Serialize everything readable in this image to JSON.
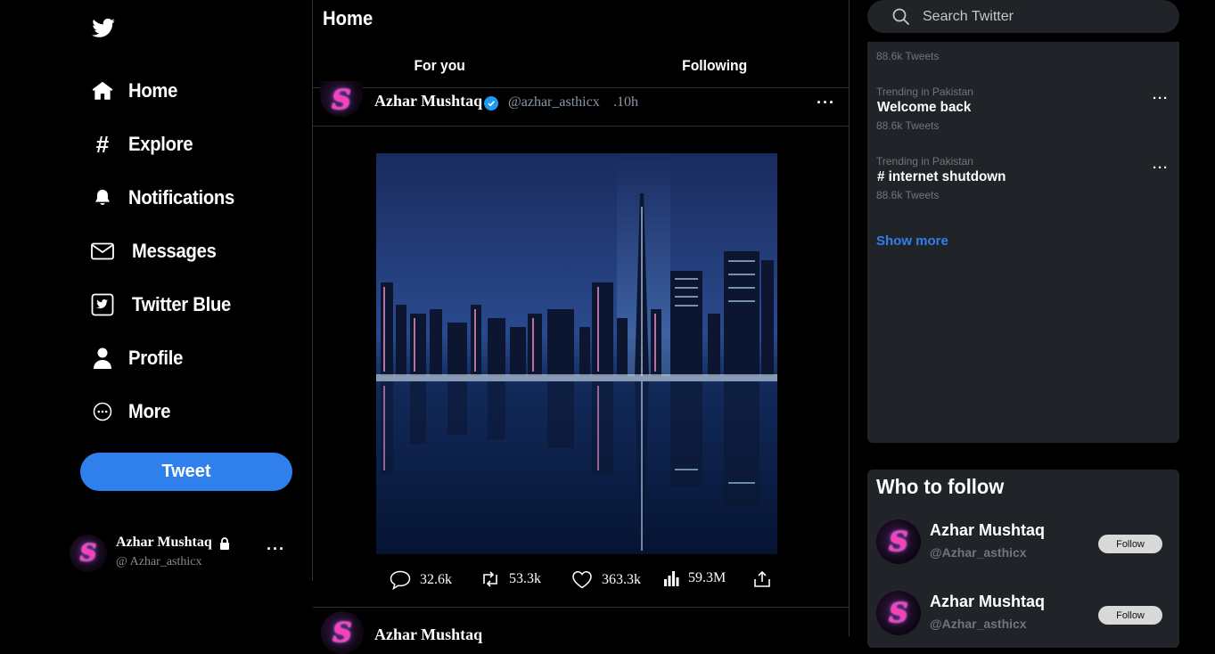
{
  "nav": {
    "items": [
      {
        "label": "Home",
        "icon": "home-icon"
      },
      {
        "label": "Explore",
        "icon": "hashtag-icon"
      },
      {
        "label": "Notifications",
        "icon": "bell-icon"
      },
      {
        "label": "Messages",
        "icon": "envelope-icon"
      },
      {
        "label": "Twitter Blue",
        "icon": "twitter-blue-icon"
      },
      {
        "label": "Profile",
        "icon": "person-icon"
      },
      {
        "label": "More",
        "icon": "more-circle-icon"
      }
    ],
    "tweet_button": "Tweet"
  },
  "account": {
    "name": "Azhar Mushtaq",
    "handle": "@ Azhar_asthicx",
    "avatar_letter": "S",
    "more": "···"
  },
  "feed": {
    "title": "Home",
    "tabs": [
      "For you",
      "Following"
    ],
    "post": {
      "author": "Azhar Mushtaq",
      "handle": "@azhar_asthicx",
      "time": ".10h",
      "more": "···",
      "image_alt": "city skyline reflection at night",
      "stats": {
        "replies": "32.6k",
        "retweets": "53.3k",
        "likes": "363.3k",
        "views": "59.3M"
      }
    },
    "next_post": {
      "author": "Azhar Mushtaq"
    }
  },
  "search": {
    "placeholder": "Search Twitter"
  },
  "trends": {
    "partial_top": {
      "count": "88.6k Tweets"
    },
    "items": [
      {
        "category": "Trending in Pakistan",
        "title": "Welcome back",
        "count": "88.6k Tweets"
      },
      {
        "category": "Trending in Pakistan",
        "title": "# internet shutdown",
        "count": "88.6k Tweets"
      }
    ],
    "show_more": "Show more"
  },
  "who_to_follow": {
    "title": "Who to follow",
    "items": [
      {
        "name": "Azhar Mushtaq",
        "handle": "@Azhar_asthicx",
        "button": "Follow"
      },
      {
        "name": "Azhar Mushtaq",
        "handle": "@Azhar_asthicx",
        "button": "Follow"
      }
    ]
  },
  "colors": {
    "accent": "#2f80ed",
    "panel": "#202327",
    "verified": "#1d9bf0"
  }
}
